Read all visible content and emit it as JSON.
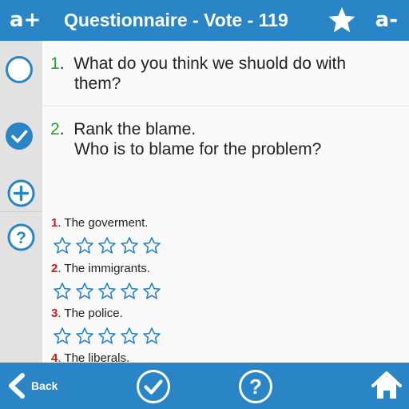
{
  "header": {
    "font_increase_label": "a+",
    "title": "Questionnaire - Vote - 119",
    "font_decrease_label": "a-",
    "favorite_icon": "star-icon"
  },
  "sidebar": {
    "icons": [
      "circle-unchecked-icon",
      "circle-check-icon",
      "plus-circle-icon",
      "question-circle-icon"
    ]
  },
  "questions": [
    {
      "number": "1",
      "text": "What do you think we shuold do with them?",
      "lines": [
        "What do you think we shuold do with",
        "them?"
      ],
      "answered": false
    },
    {
      "number": "2",
      "text": "Rank the blame. Who is to blame for the problem?",
      "lines": [
        "Rank the blame.",
        "Who is to blame for the problem?"
      ],
      "answered": true
    }
  ],
  "options": [
    {
      "number": "1",
      "label": "The goverment.",
      "stars": 5,
      "rating": 0
    },
    {
      "number": "2",
      "label": "The immigrants.",
      "stars": 5,
      "rating": 0
    },
    {
      "number": "3",
      "label": "The police.",
      "stars": 5,
      "rating": 0
    },
    {
      "number": "4",
      "label": "The liberals.",
      "stars": 5,
      "rating": 0
    }
  ],
  "footer": {
    "back_label": "Back",
    "icons": [
      "back-arrow-icon",
      "check-circle-icon",
      "help-circle-icon",
      "home-icon"
    ]
  },
  "colors": {
    "accent": "#2a85c6",
    "question_number": "#2e9a2e",
    "option_number": "#d01818",
    "star_outline": "#2a85c6"
  }
}
